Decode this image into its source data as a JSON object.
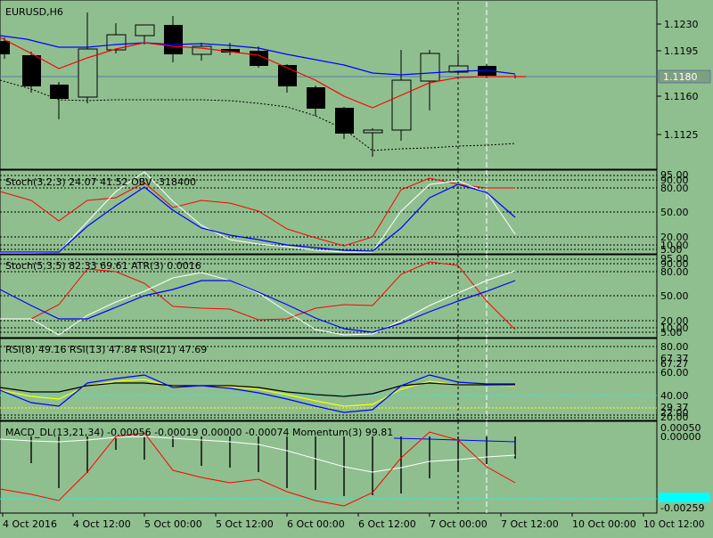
{
  "colors": {
    "background": "#8fbf8f",
    "frame": "#000000",
    "blue": "#0000ff",
    "red": "#ff0000",
    "white": "#ffffff",
    "yellow": "#ffff00",
    "price_label_bg": "#7f9f7f",
    "highlight_box": "#00ffff"
  },
  "main": {
    "symbol_label": "EURUSD,H6",
    "price_current": "1.1180",
    "price_ticks": [
      "1.1230",
      "1.1195",
      "1.1160",
      "1.1125"
    ]
  },
  "stoch1": {
    "label": "Stoch(3,2,3) 24.07 41.52 OBV -318400",
    "ticks": [
      "95.00",
      "90.00",
      "80.00",
      "50.00",
      "20.00",
      "10.00",
      "5.00"
    ]
  },
  "stoch2": {
    "label": "Stoch(5,3,5) 82.33 69.61 ATR(3) 0.0016",
    "ticks": [
      "95.00",
      "90.00",
      "80.00",
      "50.00",
      "20.00",
      "10.00",
      "5.00"
    ]
  },
  "rsi": {
    "label": "RSI(8) 49.16 RSI(13) 47.84 RSI(21) 47.69",
    "ticks": [
      "80.00",
      "67.37",
      "67.27",
      "60.00",
      "40.00",
      "29.37",
      "22.00",
      "20.00"
    ]
  },
  "macd": {
    "label": "MACD_DL(13,21,34) -0.00056 -0.00019 0.00000 -0.00074 Momentum(3) 99.81",
    "ticks": [
      "0.00050",
      "0.00000",
      "-0.00259"
    ]
  },
  "time_axis": [
    "4 Oct 2016",
    "4 Oct 12:00",
    "5 Oct 00:00",
    "5 Oct 12:00",
    "6 Oct 00:00",
    "6 Oct 12:00",
    "7 Oct 00:00",
    "7 Oct 12:00",
    "10 Oct 00:00",
    "10 Oct 12:00"
  ]
}
